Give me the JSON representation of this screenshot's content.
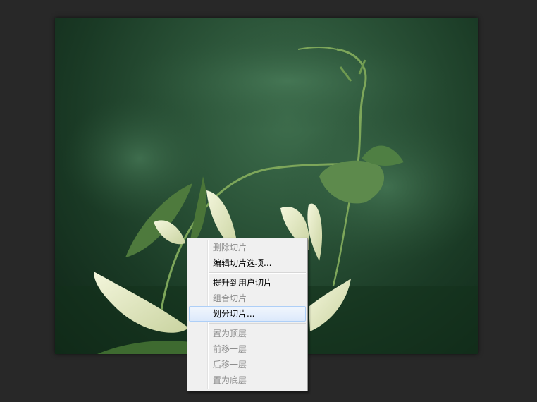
{
  "context_menu": {
    "groups": [
      {
        "items": [
          {
            "label": "删除切片",
            "enabled": false
          },
          {
            "label": "编辑切片选项...",
            "enabled": true
          }
        ]
      },
      {
        "items": [
          {
            "label": "提升到用户切片",
            "enabled": true
          },
          {
            "label": "组合切片",
            "enabled": false
          },
          {
            "label": "划分切片...",
            "enabled": true,
            "highlighted": true
          }
        ]
      },
      {
        "items": [
          {
            "label": "置为顶层",
            "enabled": false
          },
          {
            "label": "前移一层",
            "enabled": false
          },
          {
            "label": "后移一层",
            "enabled": false
          },
          {
            "label": "置为底层",
            "enabled": false
          }
        ]
      }
    ]
  },
  "colors": {
    "workspace_bg": "#282828",
    "menu_bg": "#f0f0f0",
    "menu_highlight": "#dce9fb",
    "disabled_text": "#8d8d8d"
  }
}
